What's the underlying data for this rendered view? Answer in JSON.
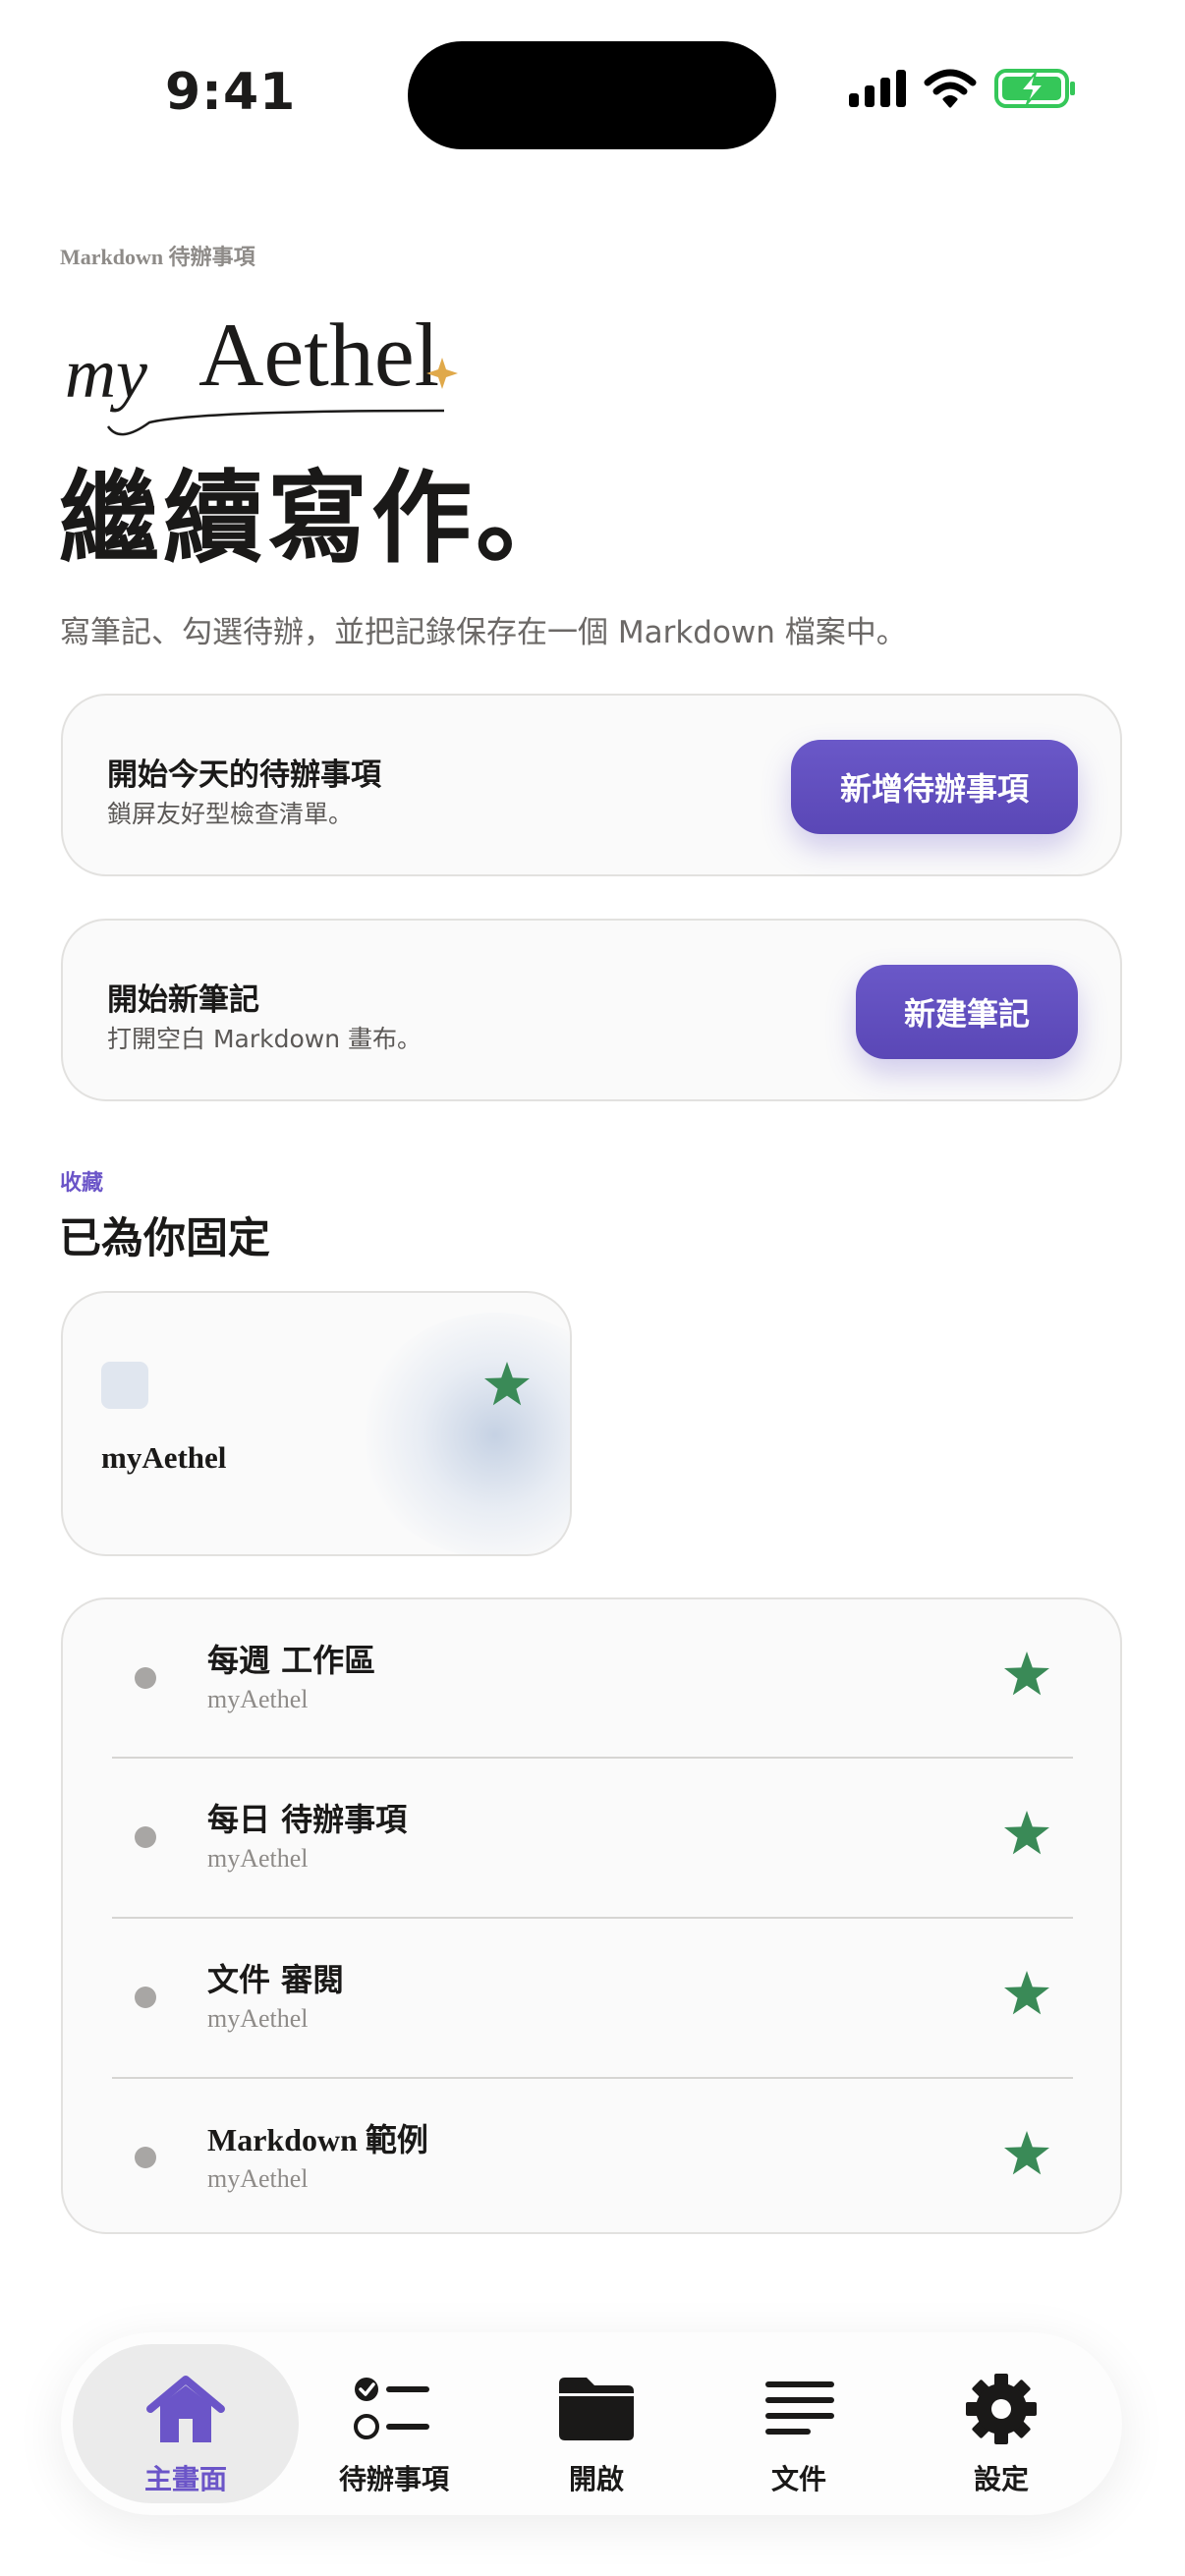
{
  "status_bar": {
    "time": "9:41"
  },
  "header": {
    "eyebrow": "Markdown 待辦事項",
    "logo_text": "myAethel",
    "title": "繼續寫作。",
    "subtitle": "寫筆記、勾選待辦，並把記錄保存在一個 Markdown 檔案中。"
  },
  "todo_card": {
    "title": "開始今天的待辦事項",
    "subtitle": "鎖屏友好型檢查清單。",
    "button": "新增待辦事項"
  },
  "note_card": {
    "title": "開始新筆記",
    "subtitle": "打開空白 Markdown 畫布。",
    "button": "新建筆記"
  },
  "favorites": {
    "eyebrow": "收藏",
    "title": "已為你固定",
    "pinned": {
      "name": "myAethel"
    },
    "items": [
      {
        "title": "每週 工作區",
        "subtitle": "myAethel"
      },
      {
        "title": "每日 待辦事項",
        "subtitle": "myAethel"
      },
      {
        "title": "文件 審閱",
        "subtitle": "myAethel"
      },
      {
        "title": "Markdown 範例",
        "subtitle": "myAethel"
      }
    ]
  },
  "tabbar": {
    "tabs": [
      {
        "label": "主畫面",
        "icon": "home-icon",
        "active": true
      },
      {
        "label": "待辦事項",
        "icon": "checklist-icon",
        "active": false
      },
      {
        "label": "開啟",
        "icon": "folder-icon",
        "active": false
      },
      {
        "label": "文件",
        "icon": "document-lines-icon",
        "active": false
      },
      {
        "label": "設定",
        "icon": "gear-icon",
        "active": false
      }
    ]
  },
  "colors": {
    "accent": "#6b55c8",
    "star": "#3a8a57",
    "logo_sparkle": "#e0a94a",
    "battery": "#35c759"
  }
}
